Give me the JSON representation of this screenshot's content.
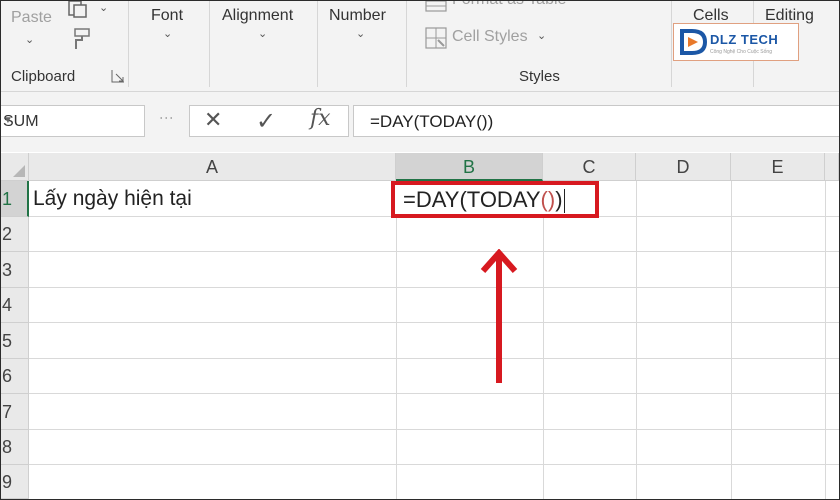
{
  "ribbon": {
    "paste_label": "Paste",
    "font_label": "Font",
    "alignment_label": "Alignment",
    "number_label": "Number",
    "format_as_table_label": "Format as Table",
    "cell_styles_label": "Cell Styles",
    "cells_label": "Cells",
    "editing_label": "Editing",
    "clipboard_group": "Clipboard",
    "styles_group": "Styles"
  },
  "watermark": {
    "brand": "DLZ TECH",
    "tagline": "Công Nghệ Cho Cuộc Sống"
  },
  "formula_bar": {
    "name_box": "SUM",
    "cancel_glyph": "✕",
    "enter_glyph": "✓",
    "fx_label": "fx",
    "formula": "=DAY(TODAY())"
  },
  "grid": {
    "columns": [
      "A",
      "B",
      "C",
      "D",
      "E"
    ],
    "rows": [
      "1",
      "2",
      "3",
      "4",
      "5",
      "6",
      "7",
      "8",
      "9"
    ],
    "cells": {
      "A1": "Lấy ngày hiện tại",
      "B1_prefix": "=DAY(TODAY",
      "B1_parens": "()",
      "B1_suffix": ")"
    }
  },
  "colors": {
    "highlight_box": "#d71920",
    "arrow": "#d71920",
    "selected_header": "#217346"
  }
}
